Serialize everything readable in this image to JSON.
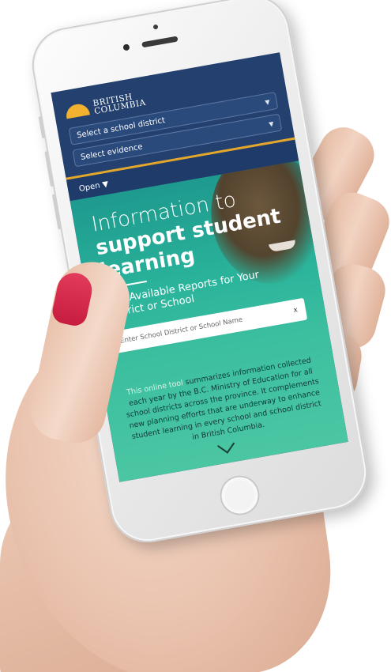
{
  "header": {
    "logo_line1": "BRITISH",
    "logo_line2": "COLUMBIA",
    "district_select": {
      "selected": "Select a school district"
    },
    "evidence_select": {
      "selected": "Select evidence"
    },
    "open_label": "Open ▼"
  },
  "hero": {
    "headline_line1": "Information to",
    "headline_line2": "support student",
    "headline_line3": "learning",
    "find_reports": "Find Available Reports for Your District or School",
    "search": {
      "placeholder": "Enter School District or School Name",
      "clear_label": "x"
    }
  },
  "description": {
    "highlight": "This online tool",
    "text": " summarizes information collected each year by the B.C. Ministry of Education for all school districts across the province. It complements new planning efforts that are underway to enhance student learning in every school and school district in British Columbia."
  },
  "colors": {
    "header_bg": "#23406f",
    "accent_rule": "#e3a82b",
    "hero_teal": "#2ab39b",
    "nail": "#d42a4c"
  }
}
